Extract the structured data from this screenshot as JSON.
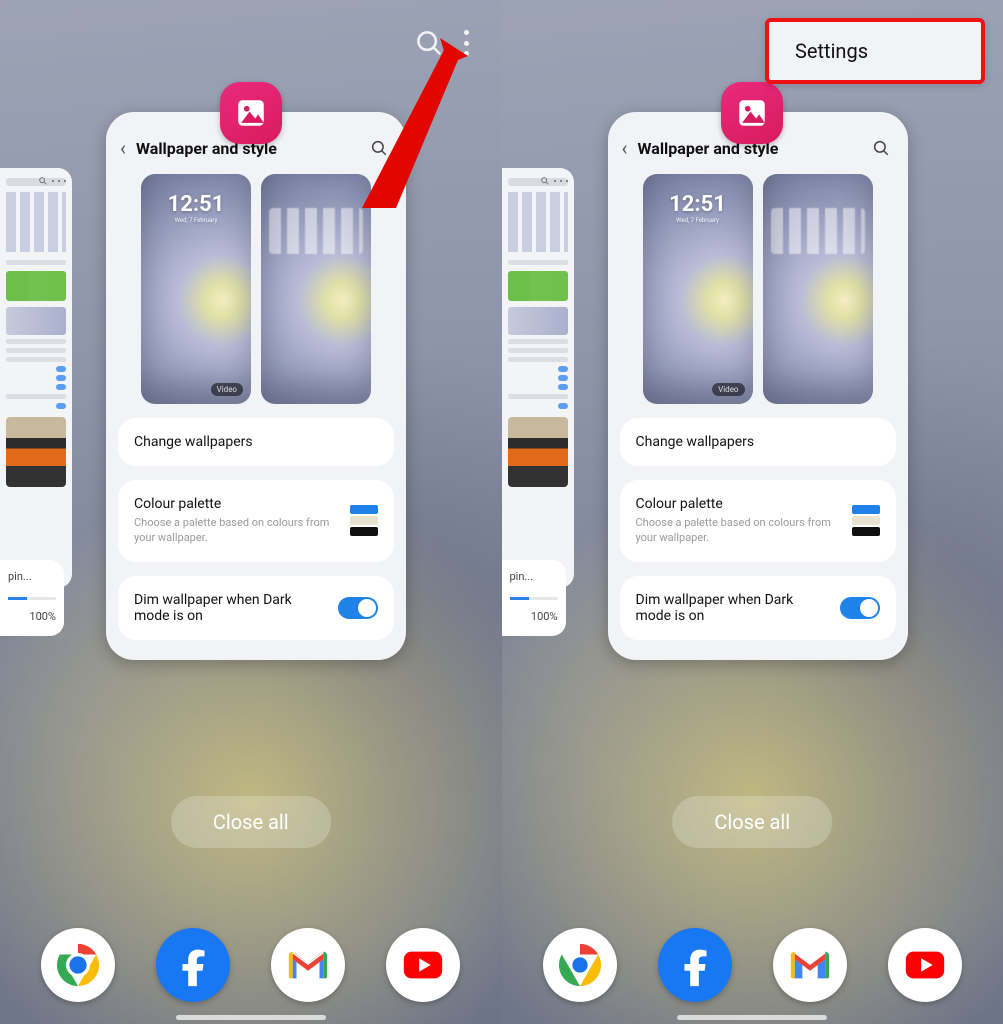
{
  "top": {
    "search_icon": "search-icon",
    "more_icon": "more-icon"
  },
  "menu": {
    "settings": "Settings"
  },
  "app_icon": "wallpaper-app-icon",
  "card": {
    "title": "Wallpaper and style",
    "lock_time": "12:51",
    "lock_date": "Wed, 7 February",
    "video_badge": "Video",
    "change": "Change wallpapers",
    "palette_title": "Colour palette",
    "palette_sub": "Choose a palette based on colours from your wallpaper.",
    "dim_label": "Dim wallpaper when Dark mode is on",
    "dim_on": true
  },
  "mini": {
    "pin": "pin...",
    "pct": "100%"
  },
  "close_all": "Close all",
  "dock": [
    "chrome",
    "facebook",
    "gmail",
    "youtube"
  ]
}
